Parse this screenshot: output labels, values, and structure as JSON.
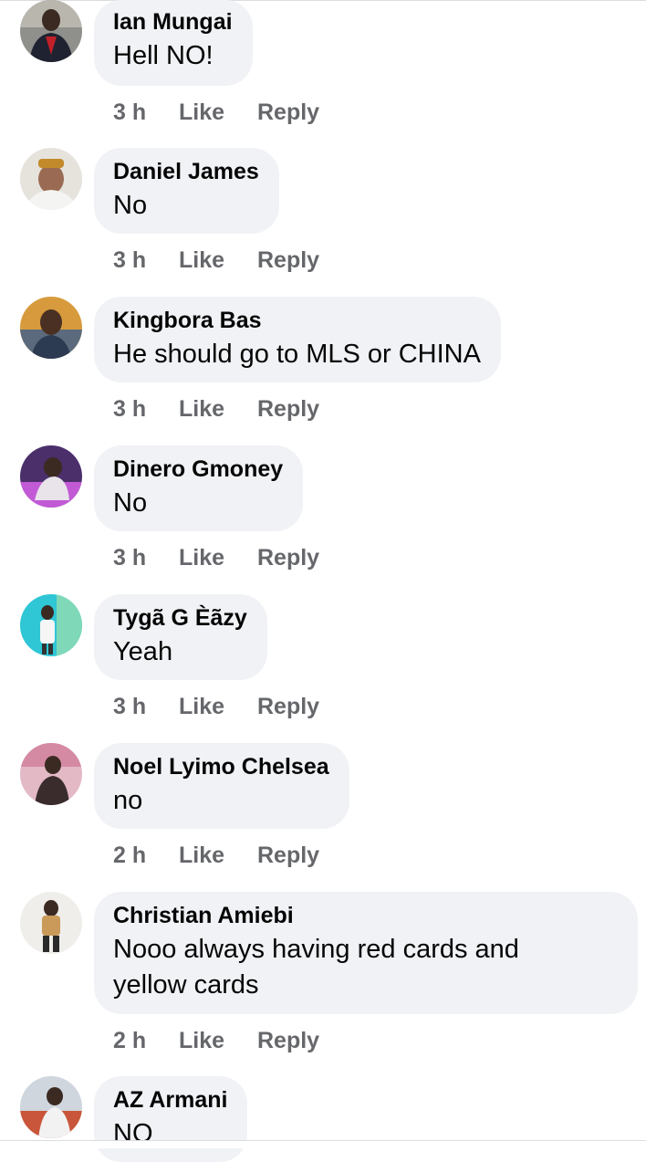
{
  "comments": [
    {
      "author": "Ian Mungai",
      "text": "Hell NO!",
      "time": "3 h",
      "like": "Like",
      "reply": "Reply"
    },
    {
      "author": "Daniel James",
      "text": "No",
      "time": "3 h",
      "like": "Like",
      "reply": "Reply"
    },
    {
      "author": "Kingbora Bas",
      "text": "He should go to MLS or CHINA",
      "time": "3 h",
      "like": "Like",
      "reply": "Reply"
    },
    {
      "author": "Dinero Gmoney",
      "text": "No",
      "time": "3 h",
      "like": "Like",
      "reply": "Reply"
    },
    {
      "author": "Tygã G Èãzy",
      "text": "Yeah",
      "time": "3 h",
      "like": "Like",
      "reply": "Reply"
    },
    {
      "author": "Noel Lyimo Chelsea",
      "text": "no",
      "time": "2 h",
      "like": "Like",
      "reply": "Reply"
    },
    {
      "author": "Christian Amiebi",
      "text": "Nooo always having red cards and\nyellow cards",
      "time": "2 h",
      "like": "Like",
      "reply": "Reply"
    },
    {
      "author": "AZ Armani",
      "text": "NO"
    }
  ],
  "colors": {
    "bubble_bg": "#f0f2f5",
    "name_text": "#050505",
    "meta_text": "#65676b",
    "divider": "#dcdde0"
  }
}
